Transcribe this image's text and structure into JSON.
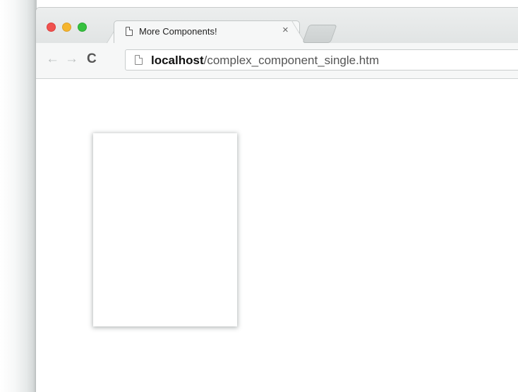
{
  "browser": {
    "tab": {
      "title": "More Components!",
      "close_icon": "×",
      "page_icon": "page-icon"
    },
    "toolbar": {
      "back_icon": "←",
      "forward_icon": "→",
      "reload_icon": "C",
      "url_host": "localhost",
      "url_path": "/complex_component_single.htm"
    },
    "colors": {
      "close": "#f0524f",
      "minimize": "#f5b52e",
      "maximize": "#36c13f"
    }
  }
}
